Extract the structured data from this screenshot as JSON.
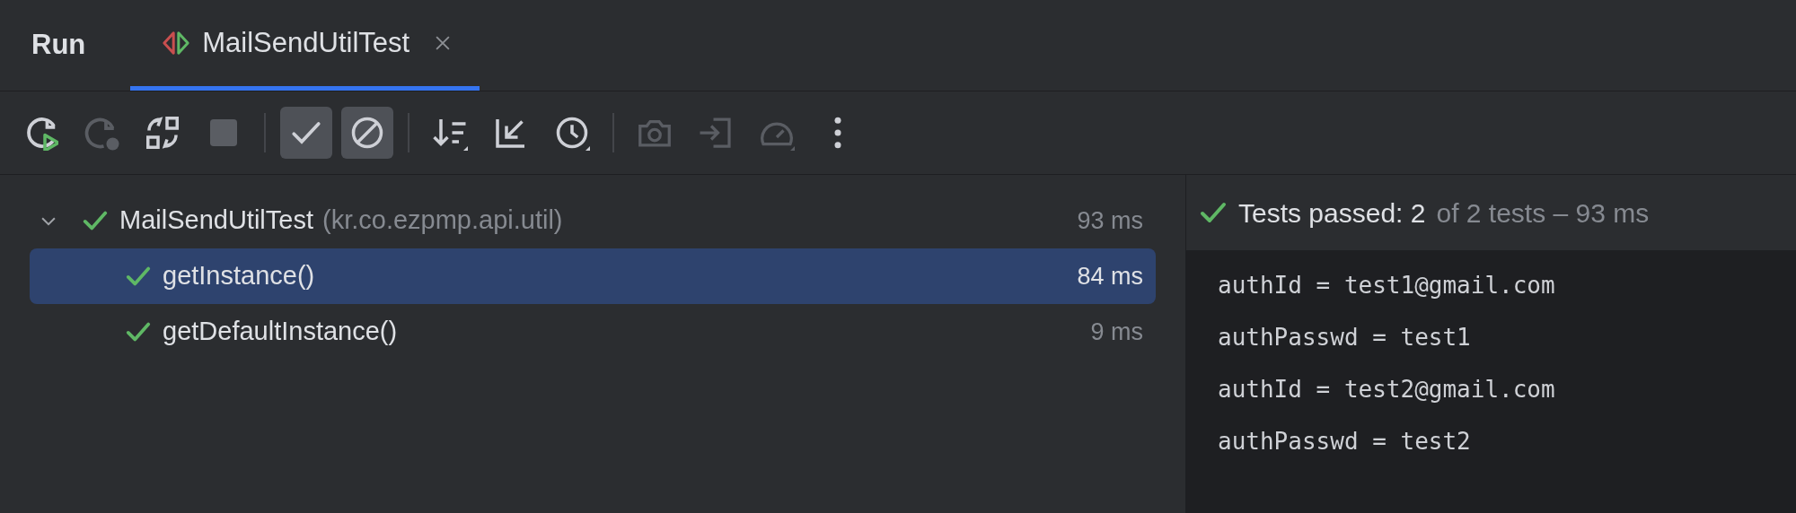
{
  "tool_window": {
    "title": "Run"
  },
  "tabs": [
    {
      "label": "MailSendUtilTest",
      "selected": true,
      "closable": true
    }
  ],
  "toolbar": [
    {
      "kind": "rerun",
      "disabled": false,
      "toggled": false
    },
    {
      "kind": "rerun-failed",
      "disabled": true,
      "toggled": false
    },
    {
      "kind": "auto-test",
      "disabled": false,
      "toggled": false
    },
    {
      "kind": "stop",
      "disabled": true,
      "toggled": false
    },
    {
      "kind": "separator"
    },
    {
      "kind": "show-passed",
      "disabled": false,
      "toggled": true
    },
    {
      "kind": "show-ignored",
      "disabled": false,
      "toggled": true
    },
    {
      "kind": "separator"
    },
    {
      "kind": "sort",
      "disabled": false,
      "toggled": false
    },
    {
      "kind": "collapse",
      "disabled": false,
      "toggled": false
    },
    {
      "kind": "history",
      "disabled": false,
      "toggled": false
    },
    {
      "kind": "separator"
    },
    {
      "kind": "camera",
      "disabled": true,
      "toggled": false
    },
    {
      "kind": "export",
      "disabled": true,
      "toggled": false
    },
    {
      "kind": "gauge",
      "disabled": true,
      "toggled": false
    },
    {
      "kind": "more",
      "disabled": false,
      "toggled": false
    }
  ],
  "test_tree": [
    {
      "name": "MailSendUtilTest",
      "package": "(kr.co.ezpmp.api.util)",
      "duration": "93 ms",
      "expanded": true,
      "selected": false,
      "passed": true,
      "children": [
        {
          "name": "getInstance()",
          "duration": "84 ms",
          "selected": true,
          "passed": true
        },
        {
          "name": "getDefaultInstance()",
          "duration": "9 ms",
          "selected": false,
          "passed": true
        }
      ]
    }
  ],
  "summary": {
    "passed": true,
    "label": "Tests passed: 2",
    "detail": "of 2 tests – 93 ms"
  },
  "console": [
    "authId = test1@gmail.com",
    "authPasswd = test1",
    "authId = test2@gmail.com",
    "authPasswd = test2"
  ]
}
